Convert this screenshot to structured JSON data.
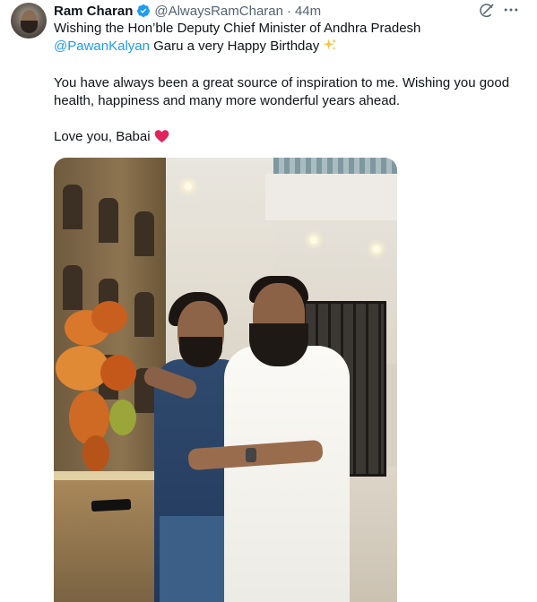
{
  "author": {
    "name": "Ram Charan",
    "handle": "@AlwaysRamCharan",
    "separator": "·",
    "time": "44m",
    "verified": true
  },
  "icons": {
    "verified": "verified-badge-icon",
    "grok": "grok-icon",
    "more": "more-options-icon",
    "sparkle": "sparkles-emoji",
    "heart": "red-heart-emoji"
  },
  "tweet": {
    "line1": "Wishing the Hon’ble Deputy Chief Minister of Andhra Pradesh",
    "mention": "@PawanKalyan",
    "line2_rest": " Garu a very Happy Birthday ",
    "para2": "You have always been a great source of inspiration to me. Wishing you good health, happiness and many more wonderful years ahead.",
    "para3": "Love you, Babai "
  },
  "colors": {
    "accent": "#1d9bf0",
    "text": "#0f1419",
    "muted": "#536471",
    "heart": "#e0245e",
    "sparkle": "#f5c542"
  }
}
